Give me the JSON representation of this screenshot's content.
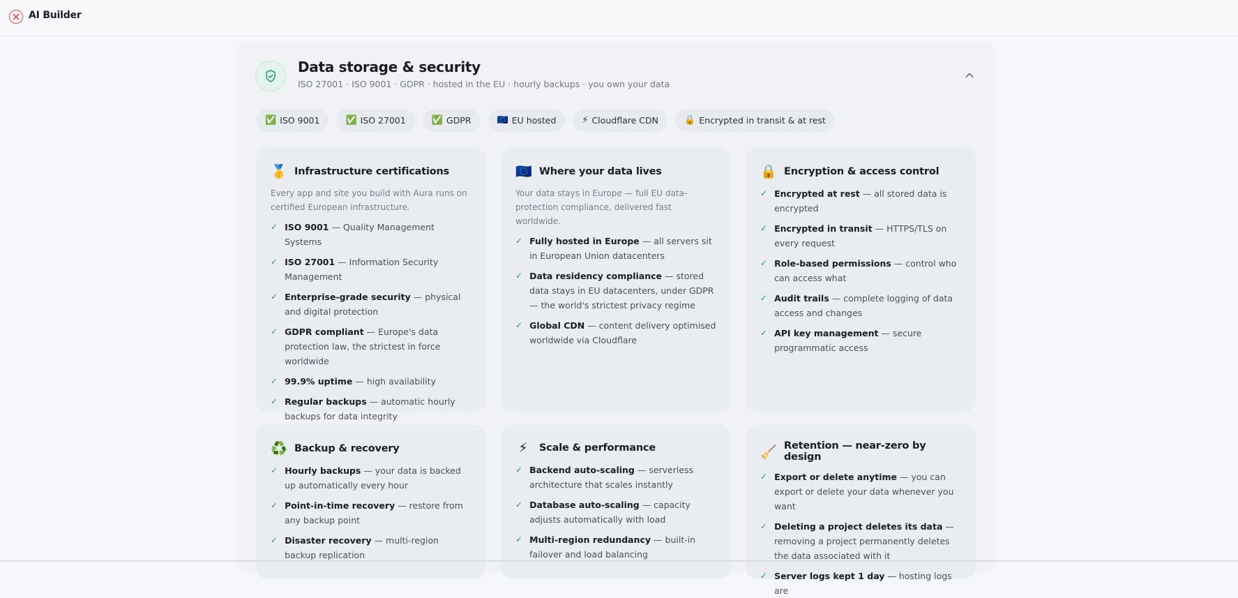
{
  "app": {
    "title": "AI Builder"
  },
  "section": {
    "title": "Data storage & security",
    "subtitle": "ISO 27001 · ISO 9001 · GDPR · hosted in the EU · hourly backups · you own your data"
  },
  "badges": [
    {
      "emoji": "✅",
      "label": "ISO 9001"
    },
    {
      "emoji": "✅",
      "label": "ISO 27001"
    },
    {
      "emoji": "✅",
      "label": "GDPR"
    },
    {
      "emoji": "🇪🇺",
      "label": "EU hosted"
    },
    {
      "emoji": "⚡",
      "label": "Cloudflare CDN"
    },
    {
      "emoji": "🔒",
      "label": "Encrypted in transit & at rest"
    }
  ],
  "cards": [
    {
      "icon": "🥇",
      "title": "Infrastructure certifications",
      "desc": "Every app and site you build with Aura runs on certified European infrastructure.",
      "items": [
        {
          "bold": "ISO 9001",
          "text": " — Quality Management Systems"
        },
        {
          "bold": "ISO 27001",
          "text": " — Information Security Management"
        },
        {
          "bold": "Enterprise-grade security",
          "text": " — physical and digital protection"
        },
        {
          "bold": "GDPR compliant",
          "text": " — Europe's data protection law, the strictest in force worldwide"
        },
        {
          "bold": "99.9% uptime",
          "text": " — high availability"
        },
        {
          "bold": "Regular backups",
          "text": " — automatic hourly backups for data integrity"
        }
      ]
    },
    {
      "icon": "🇪🇺",
      "title": "Where your data lives",
      "desc": "Your data stays in Europe — full EU data-protection compliance, delivered fast worldwide.",
      "items": [
        {
          "bold": "Fully hosted in Europe",
          "text": " — all servers sit in European Union datacenters"
        },
        {
          "bold": "Data residency compliance",
          "text": " — stored data stays in EU datacenters, under GDPR — the world's strictest privacy regime"
        },
        {
          "bold": "Global CDN",
          "text": " — content delivery optimised worldwide via Cloudflare"
        }
      ]
    },
    {
      "icon": "🔒",
      "title": "Encryption & access control",
      "desc": "",
      "items": [
        {
          "bold": "Encrypted at rest",
          "text": " — all stored data is encrypted"
        },
        {
          "bold": "Encrypted in transit",
          "text": " — HTTPS/TLS on every request"
        },
        {
          "bold": "Role-based permissions",
          "text": " — control who can access what"
        },
        {
          "bold": "Audit trails",
          "text": " — complete logging of data access and changes"
        },
        {
          "bold": "API key management",
          "text": " — secure programmatic access"
        }
      ]
    },
    {
      "icon": "♻️",
      "title": "Backup & recovery",
      "desc": "",
      "items": [
        {
          "bold": "Hourly backups",
          "text": " — your data is backed up automatically every hour"
        },
        {
          "bold": "Point-in-time recovery",
          "text": " — restore from any backup point"
        },
        {
          "bold": "Disaster recovery",
          "text": " — multi-region backup replication"
        }
      ]
    },
    {
      "icon": "⚡",
      "title": "Scale & performance",
      "desc": "",
      "items": [
        {
          "bold": "Backend auto-scaling",
          "text": " — serverless architecture that scales instantly"
        },
        {
          "bold": "Database auto-scaling",
          "text": " — capacity adjusts automatically with load"
        },
        {
          "bold": "Multi-region redundancy",
          "text": " — built-in failover and load balancing"
        }
      ]
    },
    {
      "icon": "🧹",
      "title": "Retention — near-zero by design",
      "desc": "",
      "items": [
        {
          "bold": "Export or delete anytime",
          "text": " — you can export or delete your data whenever you want"
        },
        {
          "bold": "Deleting a project deletes its data",
          "text": " — removing a project permanently deletes the data associated with it"
        },
        {
          "bold": "Server logs kept 1 day",
          "text": " — hosting logs are"
        }
      ]
    }
  ]
}
